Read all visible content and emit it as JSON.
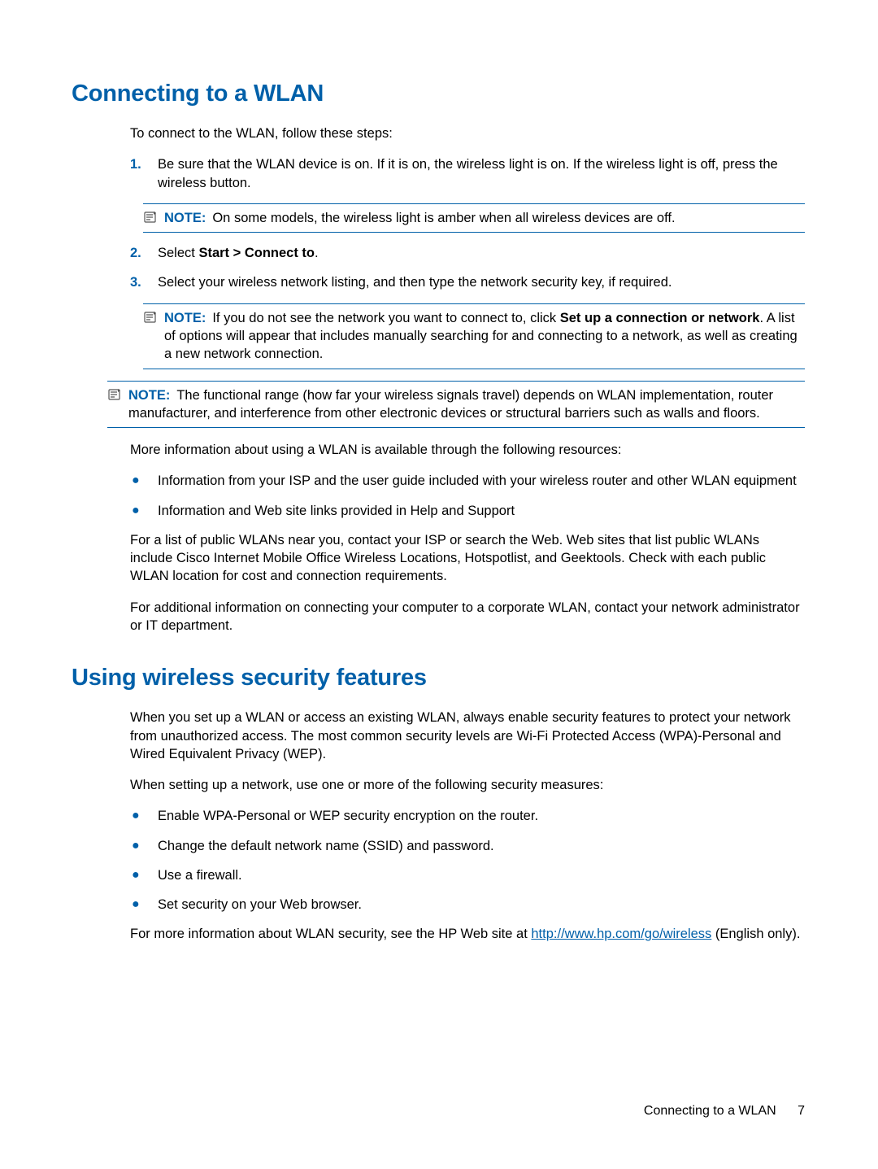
{
  "section1": {
    "heading": "Connecting to a WLAN",
    "intro": "To connect to the WLAN, follow these steps:",
    "steps": [
      {
        "num": "1.",
        "text_a": "Be sure that the WLAN device is on. If it is on, the wireless light is on. If the wireless light is off, press the wireless button."
      },
      {
        "num": "2.",
        "text_a": "Select ",
        "bold": "Start > Connect to",
        "text_b": "."
      },
      {
        "num": "3.",
        "text_a": "Select your wireless network listing, and then type the network security key, if required."
      }
    ],
    "note1": {
      "label": "NOTE:",
      "text": "On some models, the wireless light is amber when all wireless devices are off."
    },
    "note2": {
      "label": "NOTE:",
      "text_a": "If you do not see the network you want to connect to, click ",
      "bold": "Set up a connection or network",
      "text_b": ". A list of options will appear that includes manually searching for and connecting to a network, as well as creating a new network connection."
    },
    "note3": {
      "label": "NOTE:",
      "text": "The functional range (how far your wireless signals travel) depends on WLAN implementation, router manufacturer, and interference from other electronic devices or structural barriers such as walls and floors."
    },
    "more_info": "More information about using a WLAN is available through the following resources:",
    "bullets": [
      "Information from your ISP and the user guide included with your wireless router and other WLAN equipment",
      "Information and Web site links provided in Help and Support"
    ],
    "public_wlans": "For a list of public WLANs near you, contact your ISP or search the Web. Web sites that list public WLANs include Cisco Internet Mobile Office Wireless Locations, Hotspotlist, and Geektools. Check with each public WLAN location for cost and connection requirements.",
    "corporate": "For additional information on connecting your computer to a corporate WLAN, contact your network administrator or IT department."
  },
  "section2": {
    "heading": "Using wireless security features",
    "p1": "When you set up a WLAN or access an existing WLAN, always enable security features to protect your network from unauthorized access. The most common security levels are Wi-Fi Protected Access (WPA)-Personal and Wired Equivalent Privacy (WEP).",
    "p2": "When setting up a network, use one or more of the following security measures:",
    "bullets": [
      "Enable WPA-Personal or WEP security encryption on the router.",
      "Change the default network name (SSID) and password.",
      "Use a firewall.",
      "Set security on your Web browser."
    ],
    "p3_a": "For more information about WLAN security, see the HP Web site at ",
    "p3_link": "http://www.hp.com/go/wireless",
    "p3_b": " (English only)."
  },
  "footer": {
    "title": "Connecting to a WLAN",
    "page": "7"
  }
}
